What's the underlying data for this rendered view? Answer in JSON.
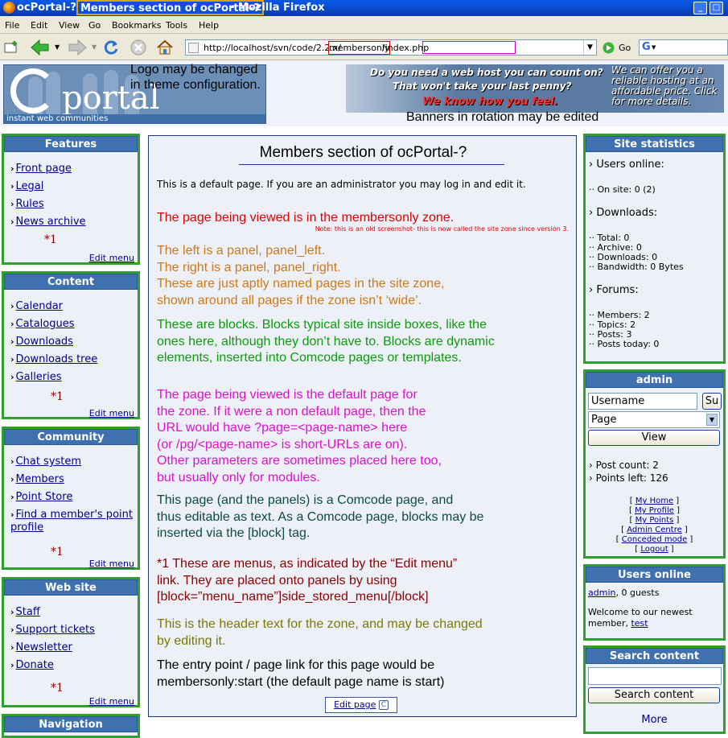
{
  "window": {
    "app_prefix": "ocPortal-? - ",
    "title": "Members section of ocPortal-?",
    "app_suffix": " - Mozilla Firefox"
  },
  "menubar": [
    "File",
    "Edit",
    "View",
    "Go",
    "Bookmarks",
    "Tools",
    "Help"
  ],
  "address": {
    "prefix": "http://localhost/svn/code/2.2.x/",
    "zone": "membersonly",
    "suffix": "/index.php",
    "go_label": "Go"
  },
  "header": {
    "logo_word": "portal",
    "logo_tagline": "instant web communities",
    "logo_note": [
      "Logo may be changed",
      "in theme configuration."
    ],
    "banner_line1": "Do you need a web host you can count on?",
    "banner_line2": "That won't take your last penny?",
    "banner_line3": "We know how you feel.",
    "banner_side": "We can offer you a reliable hosting at an affordable price. Click for more details.",
    "banner_note": "Banners in rotation may be edited"
  },
  "left_panels": [
    {
      "title": "Features",
      "items": [
        "Front page",
        "Legal",
        "Rules",
        "News archive"
      ],
      "marker": "*1",
      "edit": "Edit menu"
    },
    {
      "title": "Content",
      "items": [
        "Calendar",
        "Catalogues",
        "Downloads",
        "Downloads tree",
        "Galleries"
      ],
      "marker": "*1",
      "edit": "Edit menu"
    },
    {
      "title": "Community",
      "items": [
        "Chat system",
        "Members",
        "Point Store",
        "Find a member's point profile"
      ],
      "marker": "*1",
      "edit": "Edit menu"
    },
    {
      "title": "Web site",
      "items": [
        "Staff",
        "Support tickets",
        "Newsletter",
        "Donate"
      ],
      "marker": "*1",
      "edit": "Edit menu"
    },
    {
      "title": "Navigation"
    }
  ],
  "main": {
    "title": "Members section of ocPortal-?",
    "intro": "This is a default page. If you are an administrator you may log in and edit it.",
    "zone_note": "The page being viewed is in the membersonly zone.",
    "zone_small_note": "Note: this is an old screenshot- this is now called the site zone since version 3.",
    "panels_note": [
      "The left is a panel, panel_left.",
      "The right is a panel, panel_right.",
      "These are just aptly named pages in the site zone,",
      "shown around all pages if the zone isn’t ‘wide’."
    ],
    "blocks_note": [
      "These are blocks. Blocks typical site inside boxes, like the",
      "ones here, although they don’t have to. Blocks are dynamic",
      "elements, inserted into Comcode pages or templates."
    ],
    "default_note": [
      "The page being viewed is the default page for",
      "the zone. If it were a non default page, then the",
      "URL would have ?page=<page-name> here",
      "(or /pg/<page-name> is short-URLs are on).",
      "Other parameters are sometimes placed here too,",
      "but usually only for modules."
    ],
    "comcode_note": [
      "This page (and the panels) is a Comcode page, and",
      "thus editable as text. As a Comcode page, blocks may be",
      "inserted via the [block] tag."
    ],
    "menus_note": [
      "*1   These are menus, as indicated by the “Edit menu”",
      "link. They are placed onto panels by using",
      "[block=”menu_name”]side_stored_menu[/block]"
    ],
    "header_note": [
      "This is the header text for the zone, and may be changed",
      "by editing it."
    ],
    "entry_note": [
      "The entry point / page link for this page would be",
      "membersonly:start (the default page name is start)"
    ],
    "edit_page": "Edit page"
  },
  "site_stats": {
    "title": "Site statistics",
    "users_online": "Users online:",
    "on_site": "On site: 0 (2)",
    "downloads_heading": "Downloads:",
    "downloads": [
      "Total: 0",
      "Archive: 0",
      "Downloads: 0",
      "Bandwidth: 0 Bytes"
    ],
    "forums_heading": "Forums:",
    "forums": [
      "Members: 2",
      "Topics: 2",
      "Posts: 3",
      "Posts today: 0"
    ]
  },
  "admin_box": {
    "title": "admin",
    "username_value": "Username",
    "submit_label": "Su",
    "select_value": "Page",
    "view_button": "View",
    "post_count": "Post count:  2",
    "points_left": "Points left:  126",
    "links": [
      "My Home",
      "My Profile",
      "My Points",
      "Admin Centre",
      "Conceded mode",
      "Logout"
    ]
  },
  "users_online": {
    "title": "Users online",
    "user": "admin",
    "guests": ", 0 guests",
    "welcome": "Welcome to our newest",
    "member_label": "member, ",
    "newest": "test"
  },
  "search": {
    "title": "Search content",
    "button": "Search content",
    "more": "More"
  },
  "colors": {
    "panel_border": "#2da02d",
    "panel_header": "#3f70b0",
    "red_note": "#e00000",
    "orange_note": "#d07818",
    "green_note": "#0c9c0c",
    "magenta_note": "#e010d0",
    "teal_note": "#0b4a4a",
    "darkred_note": "#8b0000",
    "olive_note": "#7c7a00"
  }
}
